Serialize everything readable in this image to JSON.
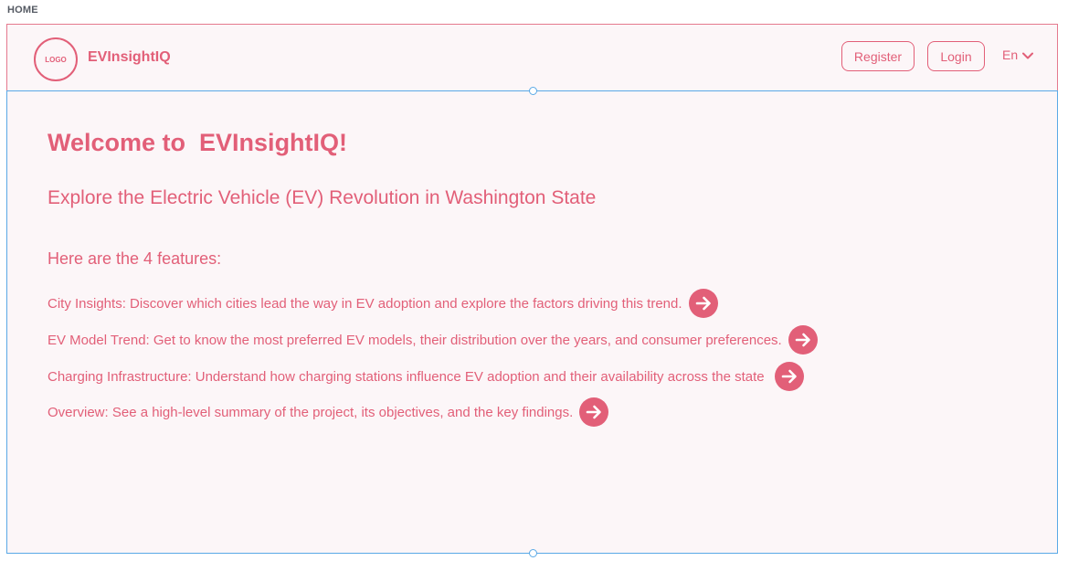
{
  "page_label": "HOME",
  "header": {
    "logo_text": "LOGO",
    "brand": "EVInsightIQ",
    "register_label": "Register",
    "login_label": "Login",
    "language": "En"
  },
  "main": {
    "title": "Welcome to  EVInsightIQ!",
    "subtitle": "Explore the Electric Vehicle (EV) Revolution in Washington State",
    "features_heading": "Here are the 4 features:",
    "features": [
      {
        "text": "City Insights: Discover which cities lead the way in EV adoption and explore the factors driving this trend.",
        "icon": "arrow-right-circle-icon"
      },
      {
        "text": "EV Model Trend: Get to know the most preferred EV models, their distribution over the years, and consumer preferences.",
        "icon": "arrow-right-circle-icon"
      },
      {
        "text": "Charging Infrastructure: Understand how charging stations influence EV adoption and their availability across the state ",
        "icon": "arrow-right-circle-icon"
      },
      {
        "text": "Overview: See a high-level summary of the project, its objectives, and the key findings.",
        "icon": "arrow-right-circle-icon"
      }
    ]
  },
  "colors": {
    "accent": "#e25f78",
    "header_border": "#e5798e",
    "selection_border": "#5aa9e6",
    "background": "#fcf6f8"
  }
}
